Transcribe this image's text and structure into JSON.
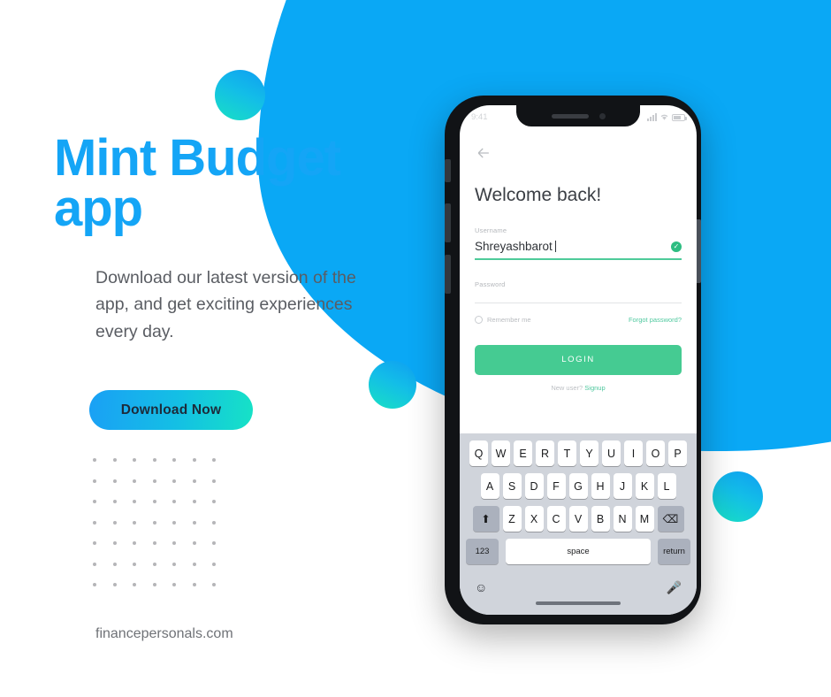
{
  "brand": {
    "accent_blue": "#14a5f6",
    "accent_cyan": "#16e2c6",
    "accent_green": "#45cb92",
    "blob_blue": "#0aa8f5"
  },
  "promo": {
    "headline": "Mint Budget app",
    "body": "Download our latest version of the app, and get exciting experiences every day.",
    "cta_label": "Download Now",
    "footer_url": "financepersonals.com"
  },
  "phone": {
    "status_bar": {
      "time": "9:41",
      "signal_icon": "cellular-bars-icon",
      "wifi_icon": "wifi-icon",
      "battery_icon": "battery-icon"
    },
    "app": {
      "back_icon": "back-arrow-icon",
      "title": "Welcome back!",
      "username": {
        "label": "Username",
        "value": "Shreyashbarot",
        "valid_icon": "check-circle-icon"
      },
      "password": {
        "label": "Password",
        "placeholder": ""
      },
      "remember_me_label": "Remember me",
      "forgot_password_label": "Forgot password?",
      "login_label": "LOGIN",
      "signup_prompt": "New user?",
      "signup_link": "Signup"
    },
    "keyboard": {
      "row1": [
        "Q",
        "W",
        "E",
        "R",
        "T",
        "Y",
        "U",
        "I",
        "O",
        "P"
      ],
      "row2": [
        "A",
        "S",
        "D",
        "F",
        "G",
        "H",
        "J",
        "K",
        "L"
      ],
      "row3": [
        "Z",
        "X",
        "C",
        "V",
        "B",
        "N",
        "M"
      ],
      "shift_icon": "shift-arrow-icon",
      "backspace_icon": "backspace-icon",
      "numbers_label": "123",
      "space_label": "space",
      "return_label": "return",
      "emoji_icon": "emoji-face-icon",
      "mic_icon": "microphone-icon"
    }
  }
}
